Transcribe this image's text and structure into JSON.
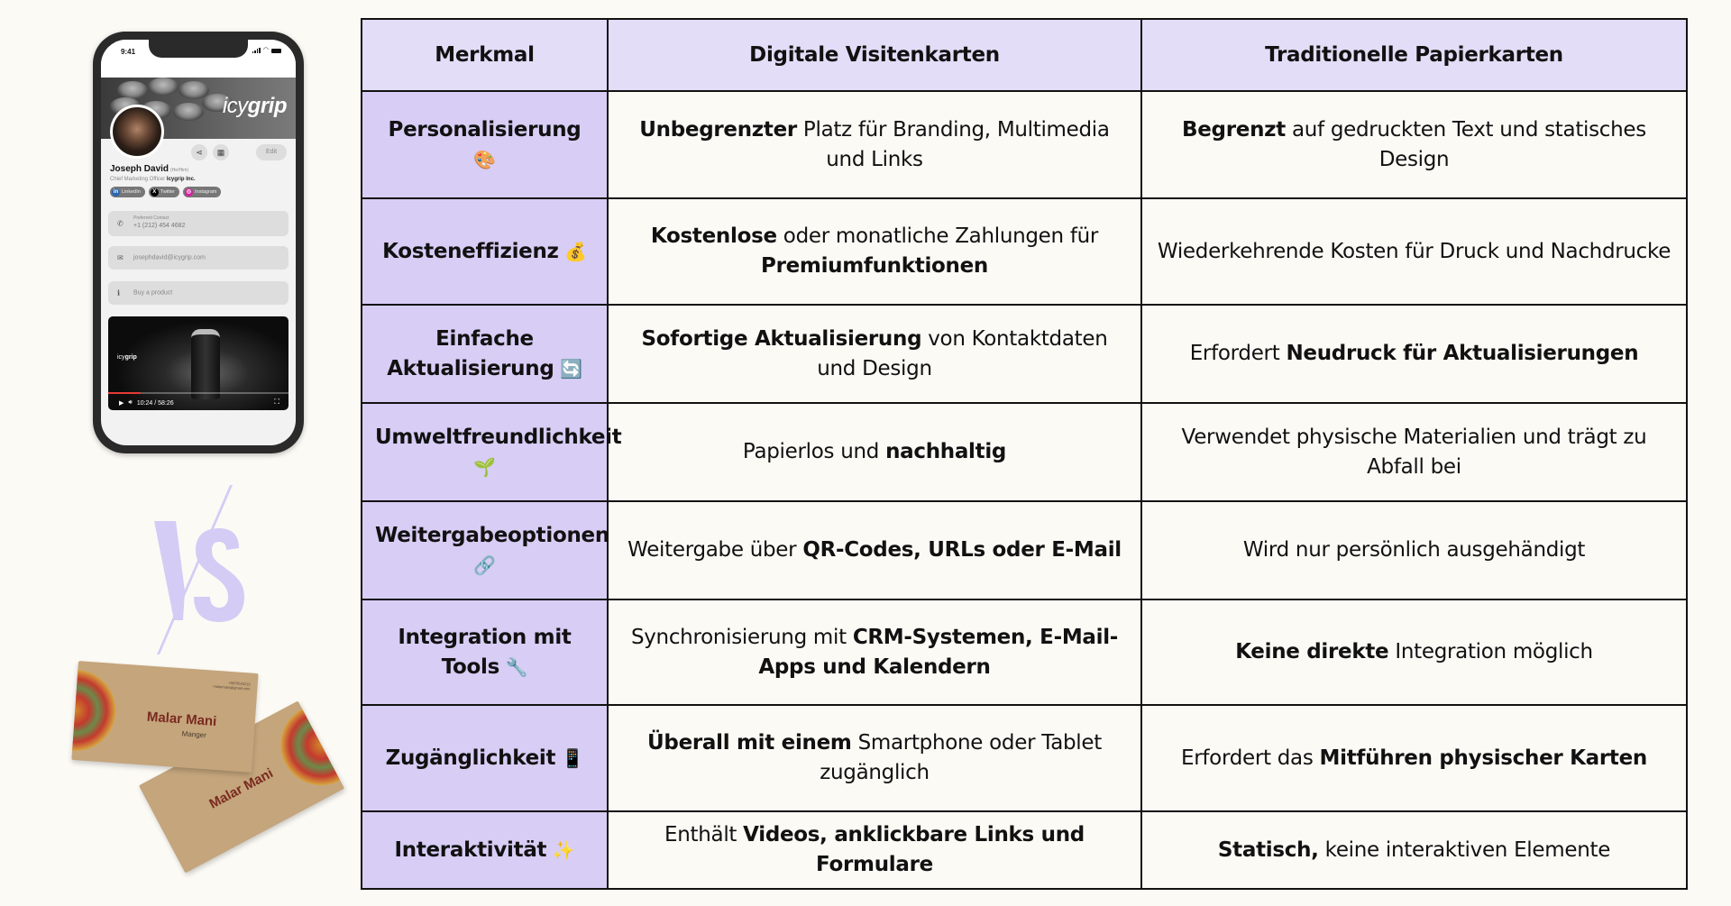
{
  "phone": {
    "status_time": "9:41",
    "brand_logo_light": "icy",
    "brand_logo_bold": "grip",
    "profile": {
      "name": "Joseph David",
      "pronouns": "(He/Him)",
      "role": "Chief Marketing Officer",
      "company": "Icygrip Inc."
    },
    "actions": {
      "share_icon": "share-icon",
      "qr_icon": "qr-code-icon",
      "edit_label": "Edit"
    },
    "socials": [
      {
        "label": "LinkedIn",
        "icon": "linkedin-icon",
        "icon_glyph": "in",
        "color": "#2867B2"
      },
      {
        "label": "Twitter",
        "icon": "x-twitter-icon",
        "icon_glyph": "X",
        "color": "#000000"
      },
      {
        "label": "Instagram",
        "icon": "instagram-icon",
        "icon_glyph": "◎",
        "color": "#D6249F"
      }
    ],
    "contacts": [
      {
        "icon": "phone-icon",
        "glyph": "✆",
        "label": "Preferred Contact",
        "value": "+1 (212) 454 4682"
      },
      {
        "icon": "mail-icon",
        "glyph": "✉",
        "label": "",
        "value": "josephdavid@icygrip.com"
      },
      {
        "icon": "info-icon",
        "glyph": "ℹ",
        "label": "",
        "value": "Buy a product"
      }
    ],
    "video": {
      "logo_light": "icy",
      "logo_bold": "grip",
      "time": "10:24 / 58:26",
      "progress_percent": 18,
      "progress_color": "#E53935"
    }
  },
  "vs_graphic": {
    "text": "VS",
    "color": "#D4CCF5"
  },
  "business_cards": {
    "front": {
      "name": "Malar Mani",
      "title": "Manger",
      "contact_lines": [
        "+9876543210",
        "malarmani@gmail.com"
      ]
    },
    "back": {
      "name": "Malar Mani"
    }
  },
  "colors": {
    "background": "#FCFAF5",
    "header_bg": "#E3DDF7",
    "feature_col_bg": "#D8CDF5",
    "border": "#111111"
  },
  "table": {
    "headers": [
      "Merkmal",
      "Digitale Visitenkarten",
      "Traditionelle Papierkarten"
    ],
    "rows": [
      {
        "feature": "Personalisierung",
        "emoji": "🎨",
        "emoji_name": "palette-icon",
        "digital": [
          {
            "b": "Unbegrenzter"
          },
          {
            "t": " Platz für Branding, Multimedia und Links"
          }
        ],
        "paper": [
          {
            "b": "Begrenzt"
          },
          {
            "t": " auf gedruckten Text und statisches Design"
          }
        ]
      },
      {
        "feature": "Kosteneffizienz",
        "emoji": "💰",
        "emoji_name": "money-bag-icon",
        "digital": [
          {
            "b": "Kostenlose"
          },
          {
            "t": " oder monatliche Zahlungen für "
          },
          {
            "b": "Premiumfunktionen"
          }
        ],
        "paper": [
          {
            "t": "Wiederkehrende Kosten für Druck und Nachdrucke"
          }
        ]
      },
      {
        "feature": "Einfache Aktualisierung",
        "emoji": "🔄",
        "emoji_name": "refresh-icon",
        "digital": [
          {
            "b": "Sofortige Aktualisierung"
          },
          {
            "t": " von Kontaktdaten und Design"
          }
        ],
        "paper": [
          {
            "t": "Erfordert "
          },
          {
            "b": "Neudruck für Aktualisierungen"
          }
        ]
      },
      {
        "feature": "Umweltfreundlichkeit",
        "emoji": "🌱",
        "emoji_name": "seedling-icon",
        "digital": [
          {
            "t": "Papierlos und "
          },
          {
            "b": "nachhaltig"
          }
        ],
        "paper": [
          {
            "t": "Verwendet physische Materialien und trägt zu Abfall bei"
          }
        ]
      },
      {
        "feature": "Weitergabeoptionen",
        "emoji": "🔗",
        "emoji_name": "link-icon",
        "digital": [
          {
            "t": "Weitergabe über "
          },
          {
            "b": "QR-Codes, URLs oder E-Mail"
          }
        ],
        "paper": [
          {
            "t": "Wird nur persönlich ausgehändigt"
          }
        ]
      },
      {
        "feature": "Integration mit Tools",
        "emoji": "🔧",
        "emoji_name": "wrench-icon",
        "digital": [
          {
            "t": "Synchronisierung mit "
          },
          {
            "b": "CRM-Systemen, E-Mail-Apps und Kalendern"
          }
        ],
        "paper": [
          {
            "b": "Keine direkte"
          },
          {
            "t": " Integration möglich"
          }
        ]
      },
      {
        "feature": "Zugänglichkeit",
        "emoji": "📱",
        "emoji_name": "mobile-phone-icon",
        "digital": [
          {
            "b": "Überall mit einem"
          },
          {
            "t": " Smartphone oder Tablet zugänglich"
          }
        ],
        "paper": [
          {
            "t": "Erfordert das "
          },
          {
            "b": "Mitführen physischer Karten"
          }
        ]
      },
      {
        "feature": "Interaktivität",
        "emoji": "✨",
        "emoji_name": "sparkles-icon",
        "digital": [
          {
            "t": "Enthält "
          },
          {
            "b": "Videos, anklickbare Links und Formulare"
          }
        ],
        "paper": [
          {
            "b": "Statisch,"
          },
          {
            "t": " keine interaktiven Elemente"
          }
        ]
      }
    ]
  }
}
